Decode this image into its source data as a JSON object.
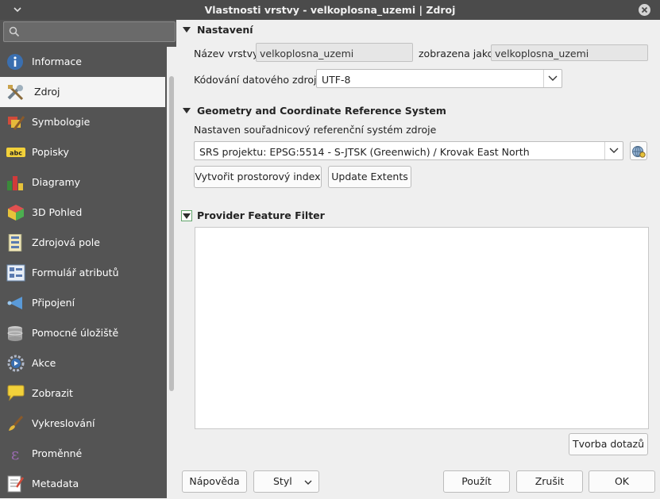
{
  "window": {
    "title": "Vlastnosti vrstvy - velkoplosna_uzemi | Zdroj"
  },
  "search": {
    "placeholder": ""
  },
  "sidebar": {
    "items": [
      {
        "label": "Informace",
        "icon": "info-icon"
      },
      {
        "label": "Zdroj",
        "icon": "source-tools-icon",
        "selected": true
      },
      {
        "label": "Symbologie",
        "icon": "paintbrush-icon"
      },
      {
        "label": "Popisky",
        "icon": "abc-label-icon"
      },
      {
        "label": "Diagramy",
        "icon": "diagram-icon"
      },
      {
        "label": "3D Pohled",
        "icon": "cube-3d-icon"
      },
      {
        "label": "Zdrojová pole",
        "icon": "fields-icon"
      },
      {
        "label": "Formulář atributů",
        "icon": "form-icon"
      },
      {
        "label": "Připojení",
        "icon": "join-icon"
      },
      {
        "label": "Pomocné úložiště",
        "icon": "storage-icon"
      },
      {
        "label": "Akce",
        "icon": "action-gear-icon"
      },
      {
        "label": "Zobrazit",
        "icon": "speech-bubble-icon"
      },
      {
        "label": "Vykreslování",
        "icon": "brush-render-icon"
      },
      {
        "label": "Proměnné",
        "icon": "epsilon-icon"
      },
      {
        "label": "Metadata",
        "icon": "metadata-icon"
      }
    ]
  },
  "settings": {
    "title": "Nastavení",
    "layer_name_label": "Název vrstvy",
    "layer_name_value": "velkoplosna_uzemi",
    "displayed_as_label": "zobrazena jako",
    "displayed_as_value": "velkoplosna_uzemi",
    "encoding_label": "Kódování datového zdroje",
    "encoding_value": "UTF-8"
  },
  "crs": {
    "title": "Geometry and Coordinate Reference System",
    "description": "Nastaven souřadnicový referenční systém zdroje",
    "value": "SRS projektu: EPSG:5514 - S-JTSK (Greenwich) / Krovak East North",
    "spatial_index_button": "Vytvořit prostorový index",
    "update_extents_button": "Update Extents"
  },
  "filter": {
    "title": "Provider Feature Filter",
    "query_builder_button": "Tvorba dotazů"
  },
  "footer": {
    "help": "Nápověda",
    "style": "Styl",
    "apply": "Použít",
    "cancel": "Zrušit",
    "ok": "OK"
  }
}
